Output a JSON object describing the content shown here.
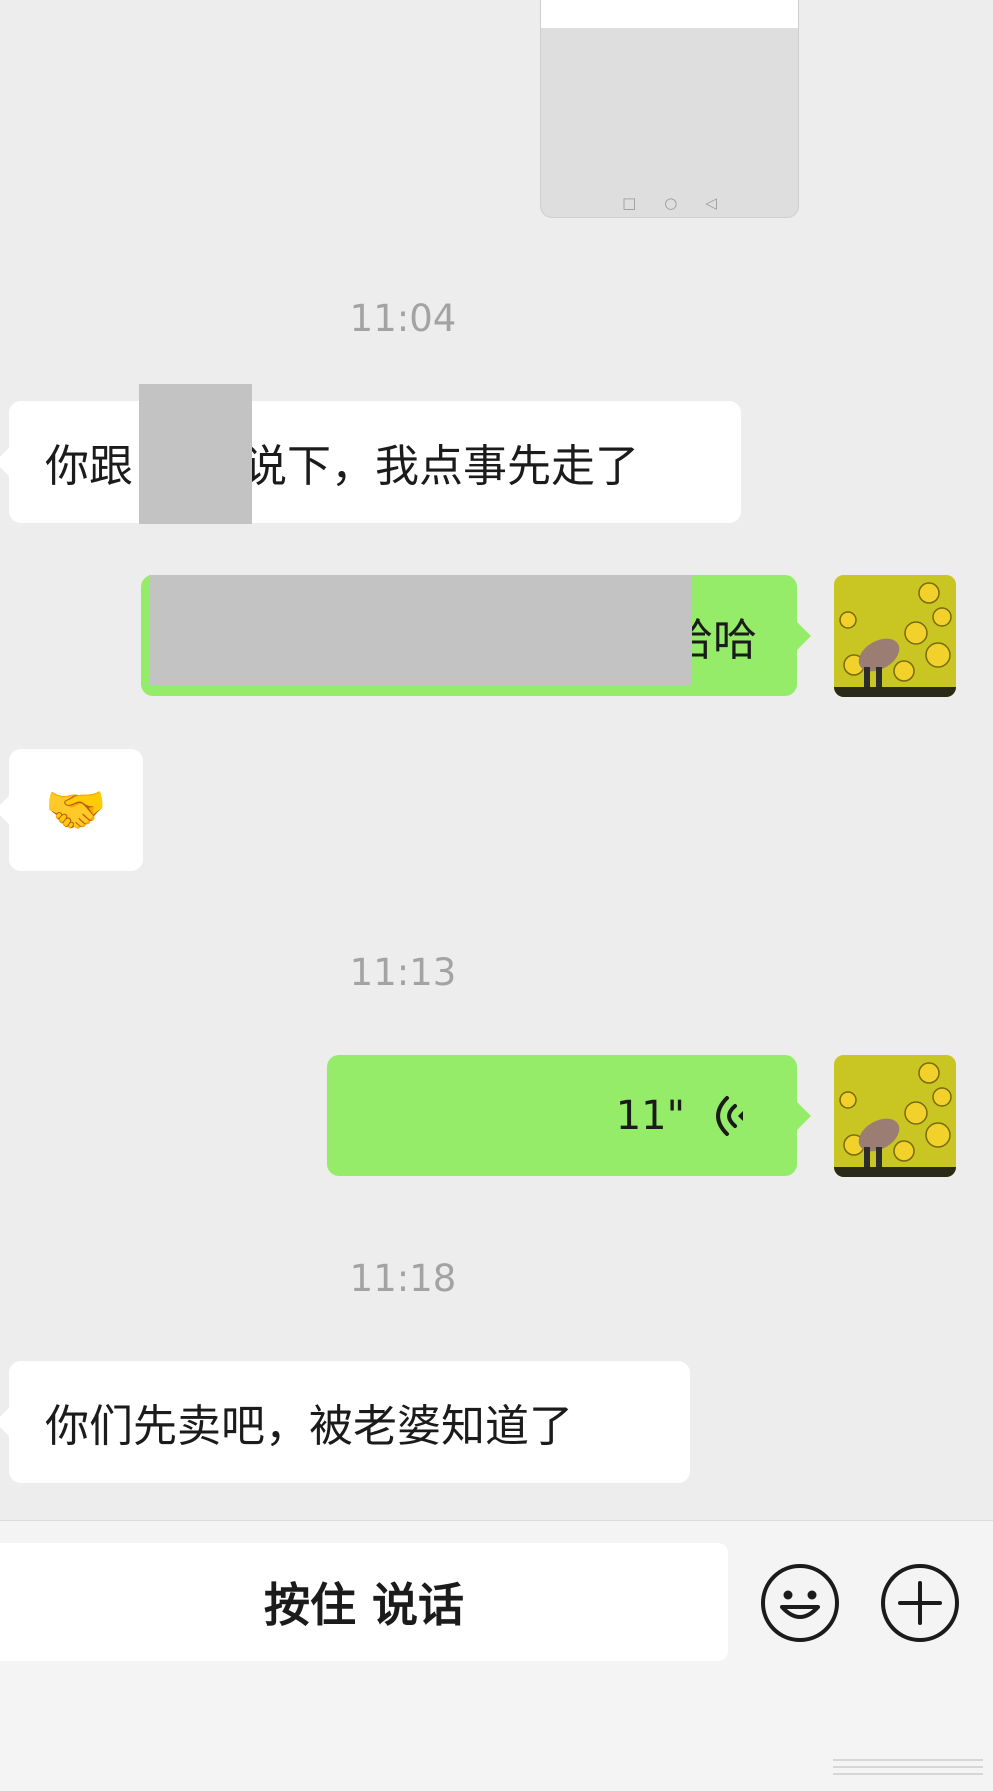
{
  "messages": {
    "time_1": "11:04",
    "msg_1": {
      "before": "你跟",
      "after": "说下，我点事先走了"
    },
    "msg_2_visible_tail": "哈哈",
    "msg_3_emoji": "🤝",
    "time_2": "11:13",
    "voice": {
      "duration": "11\""
    },
    "time_3": "11:18",
    "msg_5": "你们先卖吧，被老婆知道了"
  },
  "input_bar": {
    "hold_to_talk": "按住 说话",
    "emoji_icon": "smiley-icon",
    "more_icon": "plus-circle-icon"
  },
  "colors": {
    "background": "#ededed",
    "sent_bubble": "#95ec69",
    "received_bubble": "#ffffff",
    "timestamp": "#a3a3a3"
  }
}
